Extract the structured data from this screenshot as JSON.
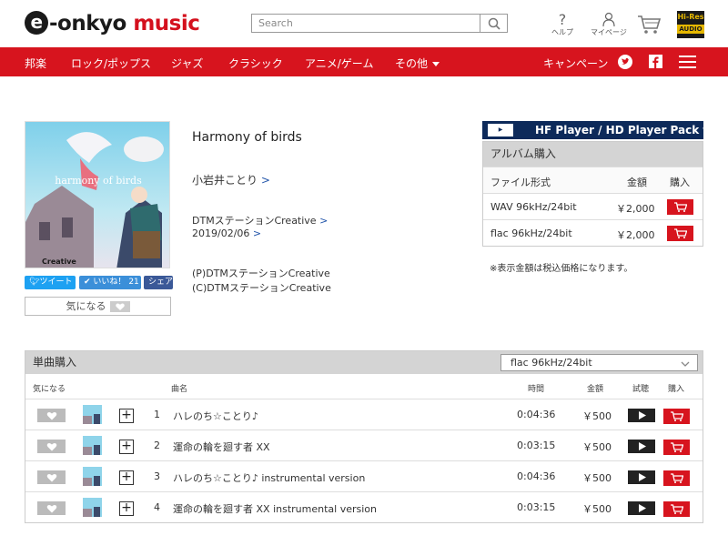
{
  "header": {
    "logo_e": "e",
    "logo_text": "-onkyo",
    "logo_music": "music",
    "search_placeholder": "Search",
    "help_label": "ヘルプ",
    "mypage_label": "マイページ",
    "hires_top": "Hi-Res",
    "hires_bottom": "AUDIO"
  },
  "nav": {
    "items": [
      "邦楽",
      "ロック/ポップス",
      "ジャズ",
      "クラシック",
      "アニメ/ゲーム",
      "その他"
    ],
    "campaign": "キャンペーン"
  },
  "album": {
    "title": "Harmony of birds",
    "artist": "小岩井ことり",
    "label": "DTMステーションCreative",
    "date": "2019/02/06",
    "p_line": "(P)DTMステーションCreative",
    "c_line": "(C)DTMステーションCreative",
    "arrow": ">",
    "cover_text": "harmony of birds",
    "cover_label": "Creative"
  },
  "social": {
    "tweet": "ツイート",
    "like": "いいね！",
    "like_count": "21",
    "share": "シェア",
    "favorite": "気になる"
  },
  "purchase": {
    "banner": "HF Player / HD Player Pack for iOS & Android",
    "header": "アルバム購入",
    "col_format": "ファイル形式",
    "col_price": "金額",
    "col_buy": "購入",
    "rows": [
      {
        "format": "WAV 96kHz/24bit",
        "price": "￥2,000"
      },
      {
        "format": "flac 96kHz/24bit",
        "price": "￥2,000"
      }
    ],
    "note": "※表示金額は税込価格になります。"
  },
  "singles": {
    "header": "単曲購入",
    "format_selected": "flac 96kHz/24bit",
    "col_fav": "気になる",
    "col_song": "曲名",
    "col_time": "時間",
    "col_price": "金額",
    "col_listen": "試聴",
    "col_buy": "購入",
    "tracks": [
      {
        "no": "1",
        "title": "ハレのち☆ことり♪",
        "time": "0:04:36",
        "price": "￥500"
      },
      {
        "no": "2",
        "title": "運命の輪を廻す者 XX",
        "time": "0:03:15",
        "price": "￥500"
      },
      {
        "no": "3",
        "title": "ハレのち☆ことり♪ instrumental version",
        "time": "0:04:36",
        "price": "￥500"
      },
      {
        "no": "4",
        "title": "運命の輪を廻す者 XX instrumental version",
        "time": "0:03:15",
        "price": "￥500"
      }
    ]
  },
  "colors": {
    "brand_red": "#d7141e",
    "header_gray": "#d4d4d4",
    "link_blue": "#2255aa",
    "twitter_blue": "#1da1f2",
    "facebook_blue": "#3b5998"
  }
}
